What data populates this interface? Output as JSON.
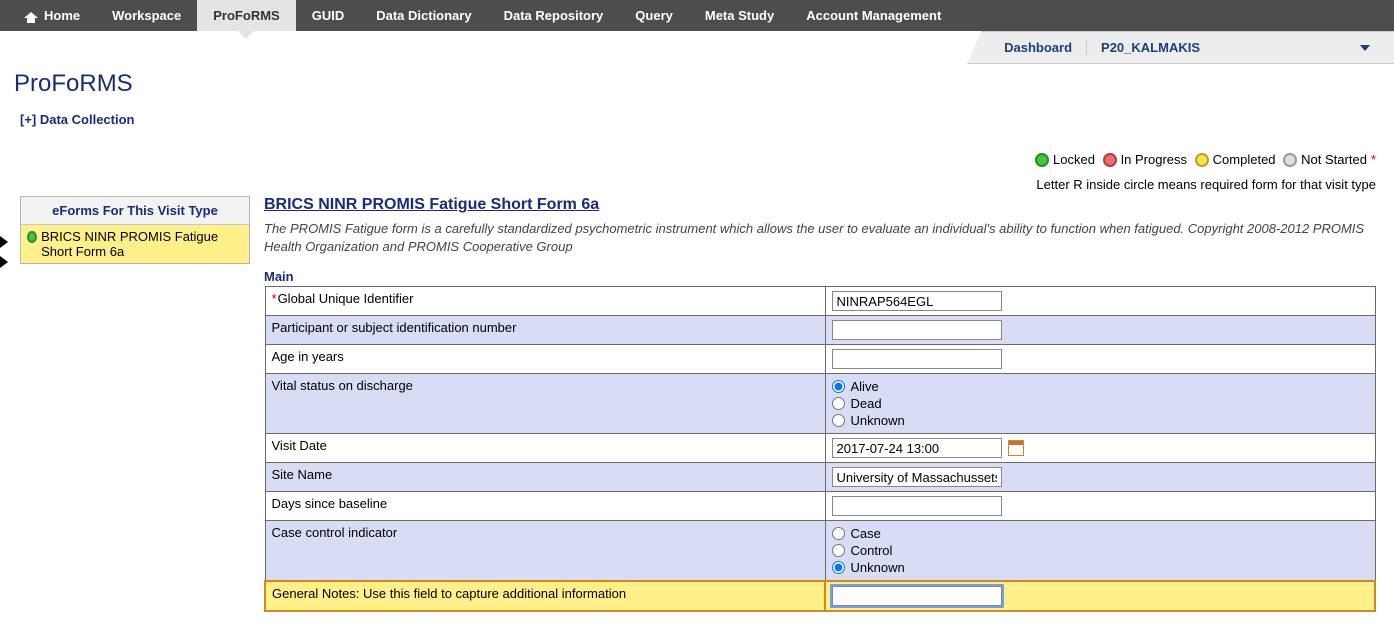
{
  "nav": {
    "home": "Home",
    "workspace": "Workspace",
    "proforms": "ProFoRMS",
    "guid": "GUID",
    "data_dictionary": "Data Dictionary",
    "data_repository": "Data Repository",
    "query": "Query",
    "meta_study": "Meta Study",
    "account": "Account Management"
  },
  "subbar": {
    "dashboard": "Dashboard",
    "study": "P20_KALMAKIS"
  },
  "page": {
    "title": "ProFoRMS",
    "expander": "[+] Data Collection"
  },
  "legend": {
    "locked": "Locked",
    "in_progress": "In Progress",
    "completed": "Completed",
    "not_started": "Not Started",
    "note": "Letter R inside circle means required form for that visit type"
  },
  "sidebar": {
    "header": "eForms For This Visit Type",
    "item0": "BRICS NINR PROMIS Fatigue Short Form 6a"
  },
  "form": {
    "title": "BRICS NINR PROMIS Fatigue Short Form 6a",
    "desc": "The PROMIS Fatigue form is a carefully standardized psychometric instrument which allows the user to evaluate an individual's ability to function when fatigued. Copyright 2008-2012 PROMIS Health Organization and PROMIS Cooperative Group",
    "section": "Main",
    "rows": {
      "guid_label": "Global Unique Identifier",
      "guid_value": "NINRAP564EGL",
      "pid_label": "Participant or subject identification number",
      "pid_value": "",
      "age_label": "Age in years",
      "age_value": "",
      "vital_label": "Vital status on discharge",
      "vital_opts": {
        "alive": "Alive",
        "dead": "Dead",
        "unknown": "Unknown"
      },
      "visit_label": "Visit Date",
      "visit_value": "2017-07-24 13:00",
      "site_label": "Site Name",
      "site_value": "University of Massachussets",
      "days_label": "Days since baseline",
      "days_value": "",
      "cci_label": "Case control indicator",
      "cci_opts": {
        "case": "Case",
        "control": "Control",
        "unknown": "Unknown"
      },
      "notes_label": "General Notes: Use this field to capture additional information",
      "notes_value": ""
    }
  }
}
